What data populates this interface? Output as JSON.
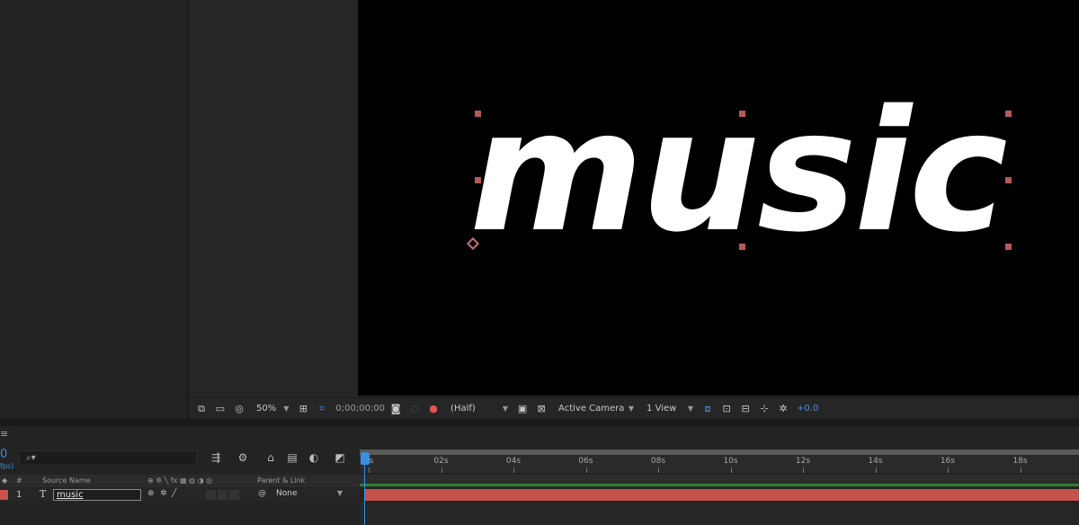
{
  "viewer": {
    "comp_text": "music",
    "background": "#000000",
    "text_color": "#ffffff",
    "handle_color": "#b45a5a"
  },
  "viewer_toolbar": {
    "zoom": "50%",
    "timecode": "0;00;00;00",
    "resolution": "(Half)",
    "camera": "Active Camera",
    "views": "1 View",
    "exposure": "+0.0"
  },
  "timeline": {
    "current_time_fragment": "0",
    "fps_fragment": "fps)",
    "search_placeholder": "",
    "ruler_labels": [
      "0s",
      "02s",
      "04s",
      "06s",
      "08s",
      "10s",
      "12s",
      "14s",
      "16s",
      "18s"
    ],
    "columns": {
      "hash": "#",
      "source_name": "Source Name",
      "parent_link": "Parent & Link"
    },
    "layers": [
      {
        "number": "1",
        "type_glyph": "T",
        "name": "music",
        "parent": "None",
        "label_color": "#c9524e"
      }
    ],
    "playhead_color": "#3a8fe0",
    "work_area_color": "#2e7d32"
  }
}
